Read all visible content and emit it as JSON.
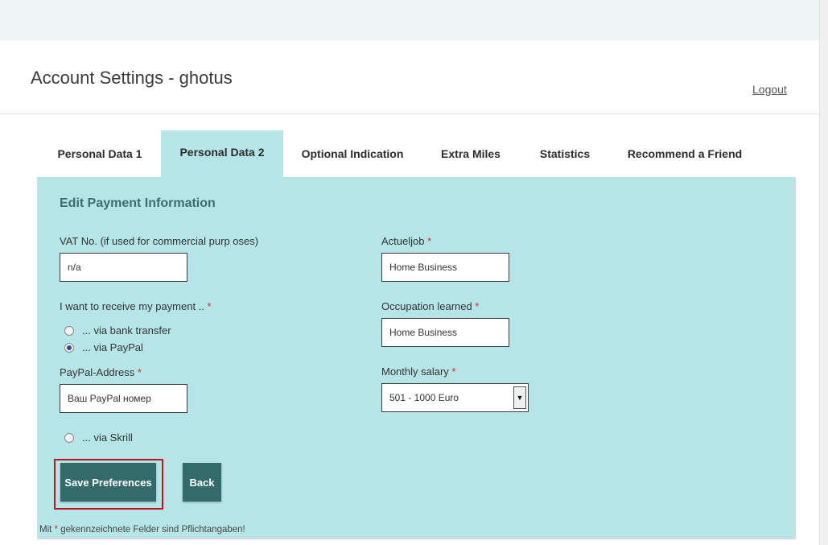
{
  "header": {
    "title": "Account Settings - ghotus",
    "logout_label": "Logout"
  },
  "tabs": [
    {
      "label": "Personal Data 1",
      "active": false
    },
    {
      "label": "Personal Data 2",
      "active": true
    },
    {
      "label": "Optional Indication",
      "active": false
    },
    {
      "label": "Extra Miles",
      "active": false
    },
    {
      "label": "Statistics",
      "active": false
    },
    {
      "label": "Recommend a Friend",
      "active": false
    }
  ],
  "form": {
    "section_title": "Edit Payment Information",
    "vat": {
      "label": "VAT No. (if used for commercial purp oses)",
      "value": "n/a"
    },
    "payment_method": {
      "label": "I want to receive my payment ..",
      "options": [
        {
          "label": "... via bank transfer",
          "checked": false
        },
        {
          "label": "... via PayPal",
          "checked": true
        },
        {
          "label": "... via Skrill",
          "checked": false
        }
      ]
    },
    "paypal": {
      "label": "PayPal-Address",
      "value": "Ваш PayPal номер"
    },
    "actueljob": {
      "label": "Actueljob",
      "value": "Home Business"
    },
    "occupation": {
      "label": "Occupation learned",
      "value": "Home Business"
    },
    "salary": {
      "label": "Monthly salary",
      "value": "501 - 1000 Euro"
    },
    "required_marker": "*",
    "save_label": "Save Preferences",
    "back_label": "Back",
    "footnote_prefix": "Mit",
    "footnote_suffix": "gekennzeichnete Felder sind Pflichtangaben!"
  },
  "colors": {
    "panel": "#b5e5e7",
    "button": "#336b6b",
    "highlight": "#c0141a",
    "required": "#d32f2f"
  }
}
